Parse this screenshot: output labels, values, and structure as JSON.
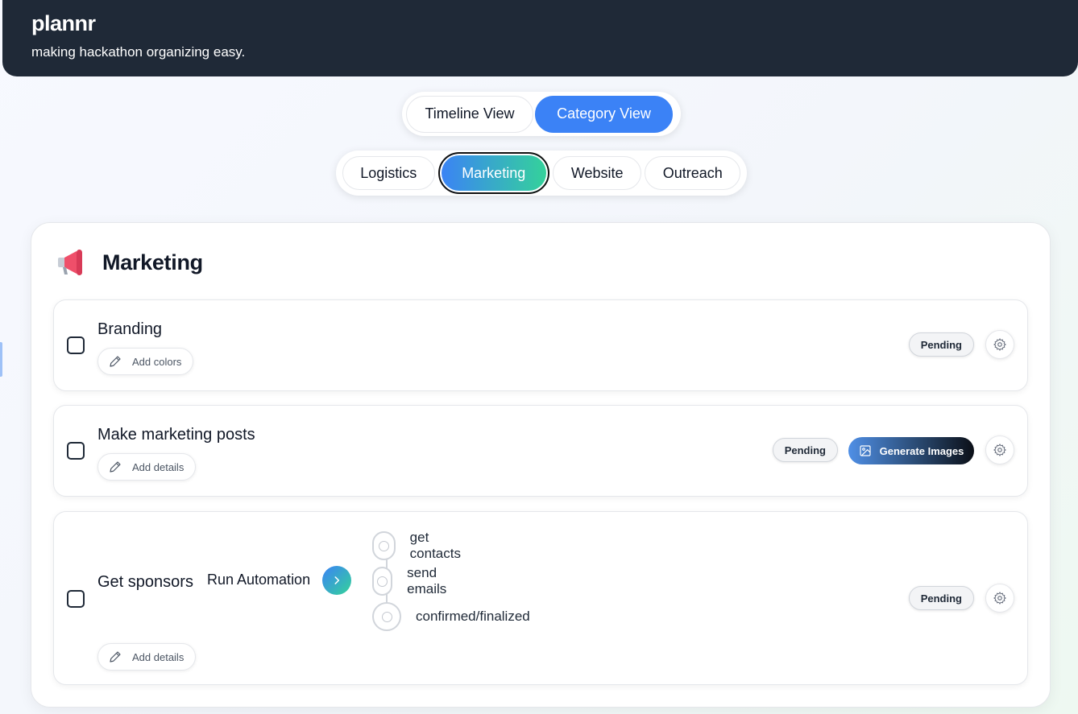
{
  "header": {
    "brand": "plannr",
    "tagline": "making hackathon organizing easy."
  },
  "view_toggle": {
    "timeline_label": "Timeline View",
    "category_label": "Category View",
    "active": "Category View"
  },
  "categories": {
    "items": [
      "Logistics",
      "Marketing",
      "Website",
      "Outreach"
    ],
    "active": "Marketing"
  },
  "section": {
    "title": "Marketing",
    "icon": "megaphone-icon"
  },
  "tasks": [
    {
      "title": "Branding",
      "add_label": "Add colors",
      "status": "Pending"
    },
    {
      "title": "Make marketing posts",
      "add_label": "Add details",
      "status": "Pending",
      "action_label": "Generate Images"
    },
    {
      "title": "Get sponsors",
      "add_label": "Add details",
      "status": "Pending",
      "automation_label": "Run Automation",
      "steps": [
        "get contacts",
        "send emails",
        "confirmed/finalized"
      ]
    }
  ],
  "colors": {
    "header_bg": "#1f2937",
    "accent_blue": "#3b82f6",
    "accent_green": "#34d399"
  }
}
